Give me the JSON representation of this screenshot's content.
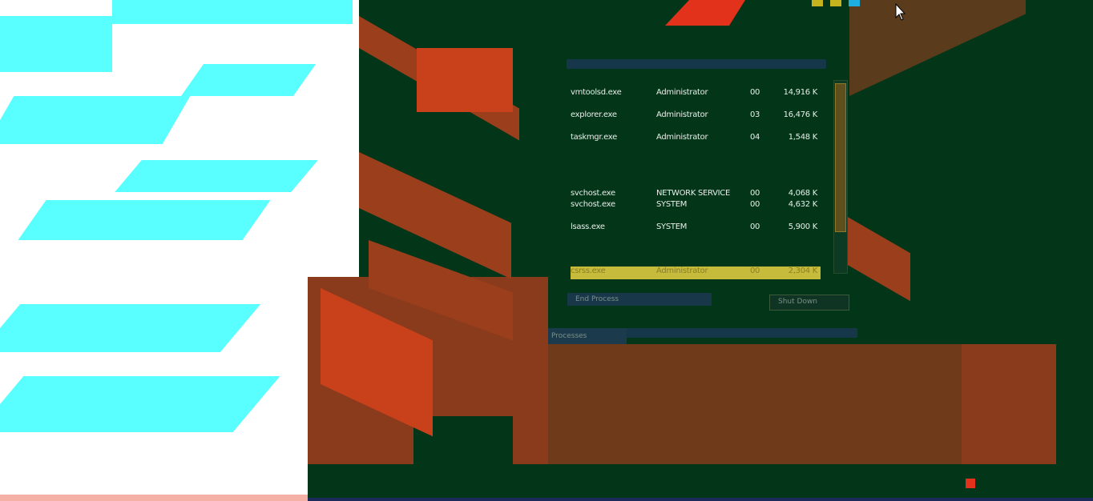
{
  "processes": [
    {
      "name": "vmtoolsd.exe",
      "user": "Administrator",
      "session": "00",
      "memory": "14,916 K"
    },
    {
      "name": "explorer.exe",
      "user": "Administrator",
      "session": "03",
      "memory": "16,476 K"
    },
    {
      "name": "taskmgr.exe",
      "user": "Administrator",
      "session": "04",
      "memory": "1,548 K"
    },
    {
      "name": "svchost.exe",
      "user": "NETWORK SERVICE",
      "session": "00",
      "memory": "4,068 K"
    },
    {
      "name": "svchost.exe",
      "user": "SYSTEM",
      "session": "00",
      "memory": "4,632 K"
    },
    {
      "name": "lsass.exe",
      "user": "SYSTEM",
      "session": "00",
      "memory": "5,900 K"
    }
  ],
  "selected": {
    "name": "csrss.exe",
    "user": "Administrator",
    "session": "00",
    "memory": "2,304 K"
  },
  "buttons": {
    "end_process": "End Process",
    "shut_down": "Shut Down"
  },
  "status": {
    "text": "Processes"
  },
  "colors": {
    "background": "#033519",
    "accent_orange": "#9b3e1c",
    "selection": "#c6bb3a",
    "cyan": "#59ffff"
  }
}
